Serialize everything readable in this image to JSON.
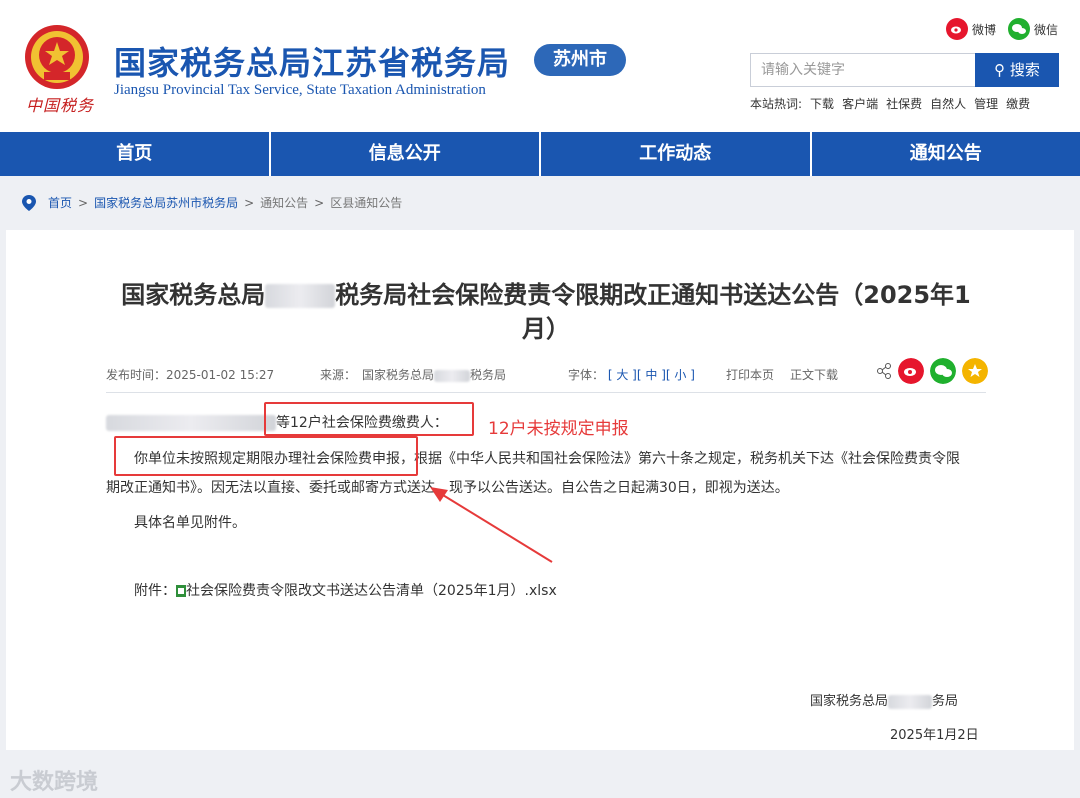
{
  "header": {
    "logo_caption": "中国税务",
    "title": "国家税务总局江苏省税务局",
    "subtitle": "Jiangsu Provincial Tax Service, State Taxation Administration",
    "city_badge": "苏州市",
    "social": {
      "weibo": "微博",
      "weixin": "微信"
    },
    "search": {
      "placeholder": "请输入关键字",
      "button": "搜索"
    },
    "hotwords_label": "本站热词:",
    "hotwords": [
      "下载",
      "客户端",
      "社保费",
      "自然人",
      "管理",
      "缴费"
    ]
  },
  "nav": [
    "首页",
    "信息公开",
    "工作动态",
    "通知公告"
  ],
  "breadcrumb": [
    "首页",
    "国家税务总局苏州市税务局",
    "通知公告",
    "区县通知公告"
  ],
  "article": {
    "title": "国家税务总局",
    "title_rest": "税务局社会保险费责令限期改正通知书送达公告（2025年1月）",
    "publish_label": "发布时间：",
    "publish_time": "2025-01-02 15:27",
    "source_label": "来源：",
    "source_a": "国家税务总局",
    "source_b": "税务局",
    "font_label": "字体：",
    "font_sizes": [
      "大",
      "中",
      "小"
    ],
    "print": "打印本页",
    "download": "正文下载",
    "para1_suffix": "等12户社会保险费缴费人：",
    "annotation": "12户未按规定申报",
    "para2_lead": "你单位未按照规定期限办理社会保险费申报，",
    "para2_rest": "根据《中华人民共和国社会保险法》第六十条之规定，税务机关下达《社会保险费责令限",
    "para2_line2": "期改正通知书》。因无法以直接、委托或邮寄方式送达，现予以公告送达。自公告之日起满30日，即视为送达。",
    "para3": "具体名单见附件。",
    "attachment_label": "附件：",
    "attachment_file": "社会保险费责令限改文书送达公告清单（2025年1月）.xlsx",
    "sign_a": "国家税务总局",
    "sign_b": "务局",
    "sign_date": "2025年1月2日"
  },
  "watermark": "大数跨境",
  "colors": {
    "brand_blue": "#1a56b0",
    "accent_red": "#e63a3a",
    "weibo": "#e6162d",
    "weixin": "#20b02e",
    "favorite": "#f4b400"
  }
}
